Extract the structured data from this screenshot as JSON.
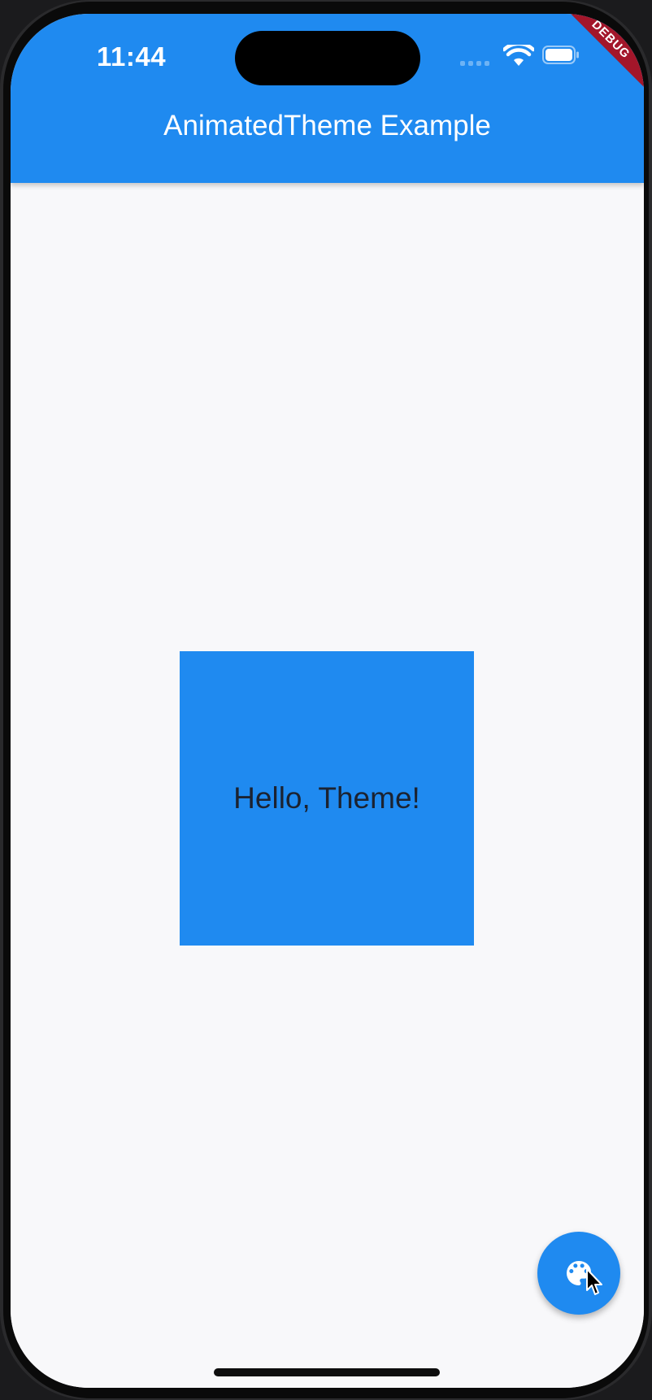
{
  "status_bar": {
    "time": "11:44",
    "wifi_icon": "wifi-icon",
    "battery_icon": "battery-icon"
  },
  "debug_banner": {
    "label": "DEBUG"
  },
  "app_bar": {
    "title": "AnimatedTheme Example",
    "background_color": "#1f8af0"
  },
  "content": {
    "box_text": "Hello, Theme!",
    "box_color": "#1f8af0",
    "page_background": "#f8f8fa"
  },
  "fab": {
    "icon": "palette-icon",
    "color": "#1f8af0"
  }
}
